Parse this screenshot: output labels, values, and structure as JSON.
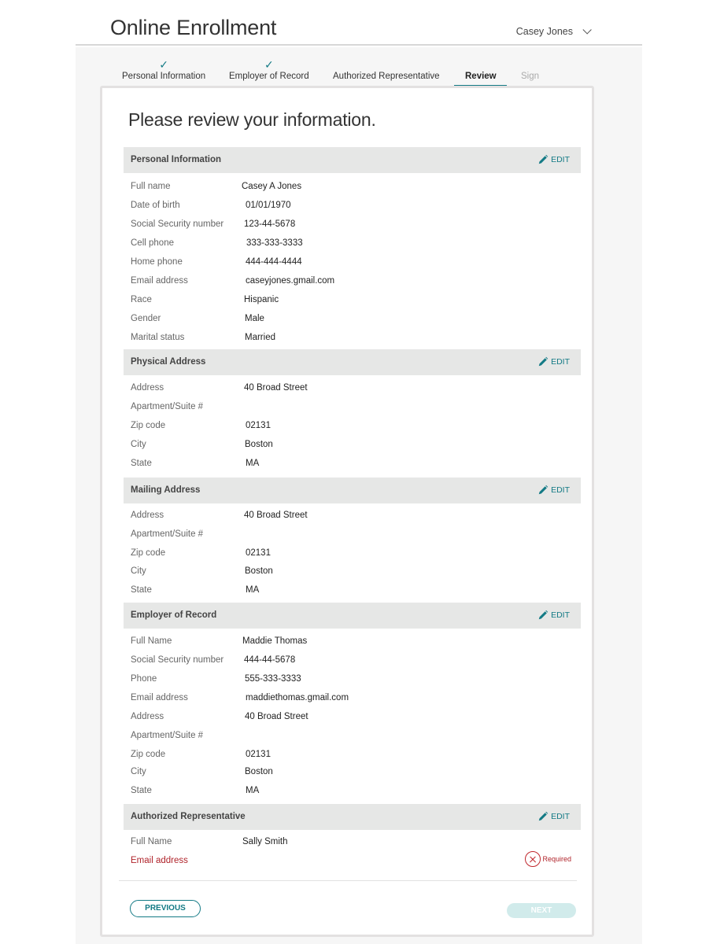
{
  "header": {
    "app_title": "Online Enrollment",
    "user_name": "Casey Jones"
  },
  "steps": [
    {
      "label": "Personal Information",
      "state": "completed"
    },
    {
      "label": "Employer of Record",
      "state": "completed"
    },
    {
      "label": "Authorized Representative",
      "state": "default"
    },
    {
      "label": "Review",
      "state": "active"
    },
    {
      "label": "Sign",
      "state": "disabled"
    }
  ],
  "review": {
    "title": "Please review your information.",
    "edit_label": "EDIT",
    "sections": [
      {
        "title": "Personal Information",
        "rows": [
          {
            "label": "Full name",
            "value": "Casey A Jones"
          },
          {
            "label": "Date of birth",
            "value": "01/01/1970"
          },
          {
            "label": "Social Security number",
            "value": "123-44-5678"
          },
          {
            "label": "Cell phone",
            "value": "333-333-3333"
          },
          {
            "label": "Home phone",
            "value": "444-444-4444"
          },
          {
            "label": "Email address",
            "value": "caseyjones.gmail.com"
          },
          {
            "label": "Race",
            "value": "Hispanic"
          },
          {
            "label": "Gender",
            "value": "Male"
          },
          {
            "label": "Marital status",
            "value": "Married"
          }
        ]
      },
      {
        "title": "Physical Address",
        "rows": [
          {
            "label": "Address",
            "value": "40 Broad Street"
          },
          {
            "label": "Apartment/Suite #",
            "value": ""
          },
          {
            "label": "Zip code",
            "value": "02131"
          },
          {
            "label": "City",
            "value": "Boston"
          },
          {
            "label": "State",
            "value": "MA"
          }
        ]
      },
      {
        "title": "Mailing Address",
        "rows": [
          {
            "label": "Address",
            "value": "40 Broad Street"
          },
          {
            "label": "Apartment/Suite #",
            "value": ""
          },
          {
            "label": "Zip code",
            "value": "02131"
          },
          {
            "label": "City",
            "value": "Boston"
          },
          {
            "label": "State",
            "value": "MA"
          }
        ]
      },
      {
        "title": "Employer of Record",
        "rows": [
          {
            "label": "Full Name",
            "value": "Maddie Thomas"
          },
          {
            "label": "Social Security number",
            "value": "444-44-5678"
          },
          {
            "label": "Phone",
            "value": "555-333-3333"
          },
          {
            "label": "Email address",
            "value": "maddiethomas.gmail.com"
          },
          {
            "label": "Address",
            "value": "40 Broad Street"
          },
          {
            "label": "Apartment/Suite #",
            "value": ""
          },
          {
            "label": "Zip code",
            "value": "02131"
          },
          {
            "label": "City",
            "value": "Boston"
          },
          {
            "label": "State",
            "value": "MA"
          }
        ]
      },
      {
        "title": "Authorized Representative",
        "rows": [
          {
            "label": "Full Name",
            "value": "Sally Smith"
          },
          {
            "label": "Email address",
            "value": "",
            "error": "Required"
          }
        ]
      }
    ]
  },
  "footer": {
    "previous_label": "PREVIOUS",
    "next_label": "NEXT"
  },
  "colors": {
    "accent": "#137a85",
    "error": "#b0242b",
    "section_bg": "#e6e7e6",
    "next_disabled": "#d1ebeb"
  }
}
